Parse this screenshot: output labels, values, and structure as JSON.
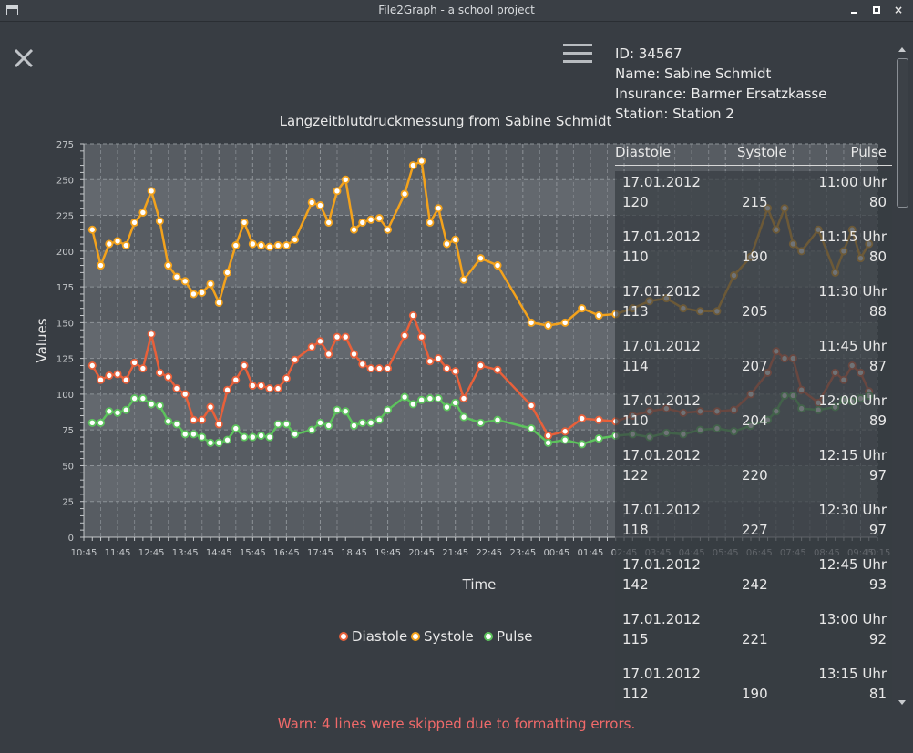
{
  "window": {
    "title": "File2Graph - a school project",
    "close_glyph": "×"
  },
  "patient": {
    "id": "ID: 34567",
    "name": "Name: Sabine Schmidt",
    "insurance": "Insurance: Barmer Ersatzkasse",
    "station": "Station: Station 2"
  },
  "table": {
    "headers": {
      "diastole": "Diastole",
      "systole": "Systole",
      "pulse": "Pulse"
    },
    "rows": [
      {
        "date": "17.01.2012",
        "time": "11:00 Uhr",
        "diastole": "120",
        "systole": "215",
        "pulse": "80"
      },
      {
        "date": "17.01.2012",
        "time": "11:15 Uhr",
        "diastole": "110",
        "systole": "190",
        "pulse": "80"
      },
      {
        "date": "17.01.2012",
        "time": "11:30 Uhr",
        "diastole": "113",
        "systole": "205",
        "pulse": "88"
      },
      {
        "date": "17.01.2012",
        "time": "11:45 Uhr",
        "diastole": "114",
        "systole": "207",
        "pulse": "87"
      },
      {
        "date": "17.01.2012",
        "time": "12:00 Uhr",
        "diastole": "110",
        "systole": "204",
        "pulse": "89"
      },
      {
        "date": "17.01.2012",
        "time": "12:15 Uhr",
        "diastole": "122",
        "systole": "220",
        "pulse": "97"
      },
      {
        "date": "17.01.2012",
        "time": "12:30 Uhr",
        "diastole": "118",
        "systole": "227",
        "pulse": "97"
      },
      {
        "date": "17.01.2012",
        "time": "12:45 Uhr",
        "diastole": "142",
        "systole": "242",
        "pulse": "93"
      },
      {
        "date": "17.01.2012",
        "time": "13:00 Uhr",
        "diastole": "115",
        "systole": "221",
        "pulse": "92"
      },
      {
        "date": "17.01.2012",
        "time": "13:15 Uhr",
        "diastole": "112",
        "systole": "190",
        "pulse": "81"
      }
    ]
  },
  "warning": "Warn: 4 lines were skipped due to formatting errors.",
  "colors": {
    "diastole": "#e8603a",
    "systole": "#f3a21c",
    "pulse": "#5dc25d",
    "warning": "#f06a6a"
  },
  "icons": {
    "close": "close-icon",
    "menu": "hamburger-menu-icon"
  },
  "chart_data": {
    "type": "line",
    "title": "Langzeitblutdruckmessung from Sabine Schmidt",
    "xlabel": "Time",
    "ylabel": "Values",
    "ylim": [
      0,
      275
    ],
    "y_ticks": [
      0,
      25,
      50,
      75,
      100,
      125,
      150,
      175,
      200,
      225,
      250,
      275
    ],
    "x_ticks": [
      "10:45",
      "11:45",
      "12:45",
      "13:45",
      "14:45",
      "15:45",
      "16:45",
      "17:45",
      "18:45",
      "19:45",
      "20:45",
      "21:45",
      "22:45",
      "23:45",
      "00:45",
      "01:45",
      "02:45",
      "03:45",
      "04:45",
      "05:45",
      "06:45",
      "07:45",
      "08:45",
      "09:45",
      "10:15"
    ],
    "x_range_hours": [
      10.75,
      34.25
    ],
    "grid": true,
    "legend_position": "bottom",
    "x": [
      11.0,
      11.25,
      11.5,
      11.75,
      12.0,
      12.25,
      12.5,
      12.75,
      13.0,
      13.25,
      13.5,
      13.75,
      14.0,
      14.25,
      14.5,
      14.75,
      15.0,
      15.25,
      15.5,
      15.75,
      16.0,
      16.25,
      16.5,
      16.75,
      17.0,
      17.5,
      17.75,
      18.0,
      18.25,
      18.5,
      18.75,
      19.0,
      19.25,
      19.5,
      19.75,
      20.25,
      20.5,
      20.75,
      21.0,
      21.25,
      21.5,
      21.75,
      22.0,
      22.5,
      23.0,
      24.0,
      24.5,
      25.0,
      25.5,
      26.0,
      26.5,
      27.0,
      27.5,
      28.0,
      28.5,
      29.0,
      29.5,
      30.0,
      30.5,
      31.0,
      31.25,
      31.5,
      31.75,
      32.0,
      32.5,
      33.0,
      33.25,
      33.5,
      33.75,
      34.0
    ],
    "series": [
      {
        "name": "Diastole",
        "values": [
          120,
          110,
          113,
          114,
          110,
          122,
          118,
          142,
          115,
          112,
          104,
          100,
          82,
          82,
          91,
          79,
          103,
          110,
          120,
          106,
          106,
          104,
          104,
          111,
          124,
          133,
          137,
          128,
          140,
          140,
          128,
          121,
          118,
          118,
          118,
          141,
          155,
          140,
          123,
          125,
          118,
          116,
          97,
          120,
          117,
          92,
          71,
          74,
          83,
          82,
          81,
          85,
          88,
          90,
          87,
          88,
          88,
          89,
          100,
          115,
          130,
          125,
          125,
          103,
          94,
          115,
          110,
          120,
          115,
          102
        ]
      },
      {
        "name": "Systole",
        "values": [
          215,
          190,
          205,
          207,
          204,
          220,
          227,
          242,
          221,
          190,
          182,
          179,
          170,
          171,
          177,
          164,
          185,
          204,
          220,
          205,
          204,
          203,
          204,
          204,
          208,
          234,
          232,
          220,
          242,
          250,
          215,
          220,
          222,
          223,
          215,
          240,
          260,
          263,
          220,
          230,
          205,
          208,
          180,
          195,
          190,
          150,
          148,
          150,
          160,
          155,
          156,
          160,
          165,
          167,
          160,
          158,
          158,
          183,
          196,
          230,
          215,
          230,
          205,
          200,
          215,
          185,
          200,
          215,
          195,
          205
        ]
      },
      {
        "name": "Pulse",
        "values": [
          80,
          80,
          88,
          87,
          89,
          97,
          97,
          93,
          92,
          81,
          79,
          72,
          72,
          70,
          66,
          66,
          68,
          76,
          70,
          70,
          71,
          70,
          79,
          79,
          72,
          75,
          80,
          78,
          89,
          88,
          78,
          80,
          80,
          82,
          89,
          98,
          93,
          96,
          97,
          97,
          91,
          94,
          84,
          80,
          82,
          76,
          66,
          68,
          65,
          69,
          71,
          72,
          70,
          73,
          72,
          75,
          76,
          74,
          78,
          82,
          88,
          99,
          99,
          90,
          89,
          91,
          96,
          95,
          97,
          99
        ]
      }
    ]
  }
}
